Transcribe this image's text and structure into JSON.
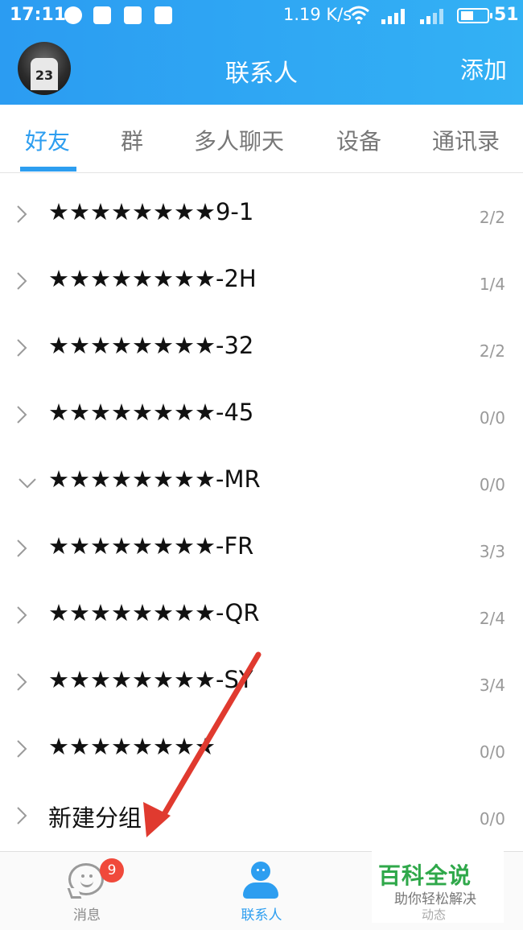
{
  "status_bar": {
    "time": "17:11",
    "speed": "1.19 K/s",
    "battery_percent": "51",
    "battery_level": 0.51,
    "icons": [
      "chat-bubble-icon",
      "alipay-icon",
      "mail-icon",
      "app-icon",
      "wifi-icon",
      "4g-signal-icon",
      "signal-icon",
      "battery-icon"
    ]
  },
  "header": {
    "title": "联系人",
    "add_label": "添加"
  },
  "tabs": [
    {
      "label": "好友",
      "active": true
    },
    {
      "label": "群",
      "active": false
    },
    {
      "label": "多人聊天",
      "active": false
    },
    {
      "label": "设备",
      "active": false
    },
    {
      "label": "通讯录",
      "active": false
    }
  ],
  "groups": [
    {
      "name": "★★★★★★★★9-1",
      "count": "2/2",
      "expanded": false
    },
    {
      "name": "★★★★★★★★-2H",
      "count": "1/4",
      "expanded": false
    },
    {
      "name": "★★★★★★★★-32",
      "count": "2/2",
      "expanded": false
    },
    {
      "name": "★★★★★★★★-45",
      "count": "0/0",
      "expanded": false
    },
    {
      "name": "★★★★★★★★-MR",
      "count": "0/0",
      "expanded": true
    },
    {
      "name": "★★★★★★★★-FR",
      "count": "3/3",
      "expanded": false
    },
    {
      "name": "★★★★★★★★-QR",
      "count": "2/4",
      "expanded": false
    },
    {
      "name": "★★★★★★★★-SY",
      "count": "3/4",
      "expanded": false
    },
    {
      "name": "★★★★★★★★",
      "count": "0/0",
      "expanded": false
    },
    {
      "name": "新建分组",
      "count": "0/0",
      "expanded": false
    }
  ],
  "bottom_nav": {
    "messages_label": "消息",
    "messages_badge": "9",
    "contacts_label": "联系人",
    "dynamic_label": "动态"
  },
  "watermark": {
    "title": "百科全说",
    "subtitle": "助你轻松解决"
  },
  "avatar": {
    "jersey_number": "23"
  },
  "colors": {
    "accent": "#2d9ef0",
    "header_gradient_start": "#2b9cf2",
    "header_gradient_end": "#33b1f4",
    "badge": "#f0493b",
    "arrow": "#e03a2f",
    "watermark_green": "#2fa84a"
  }
}
